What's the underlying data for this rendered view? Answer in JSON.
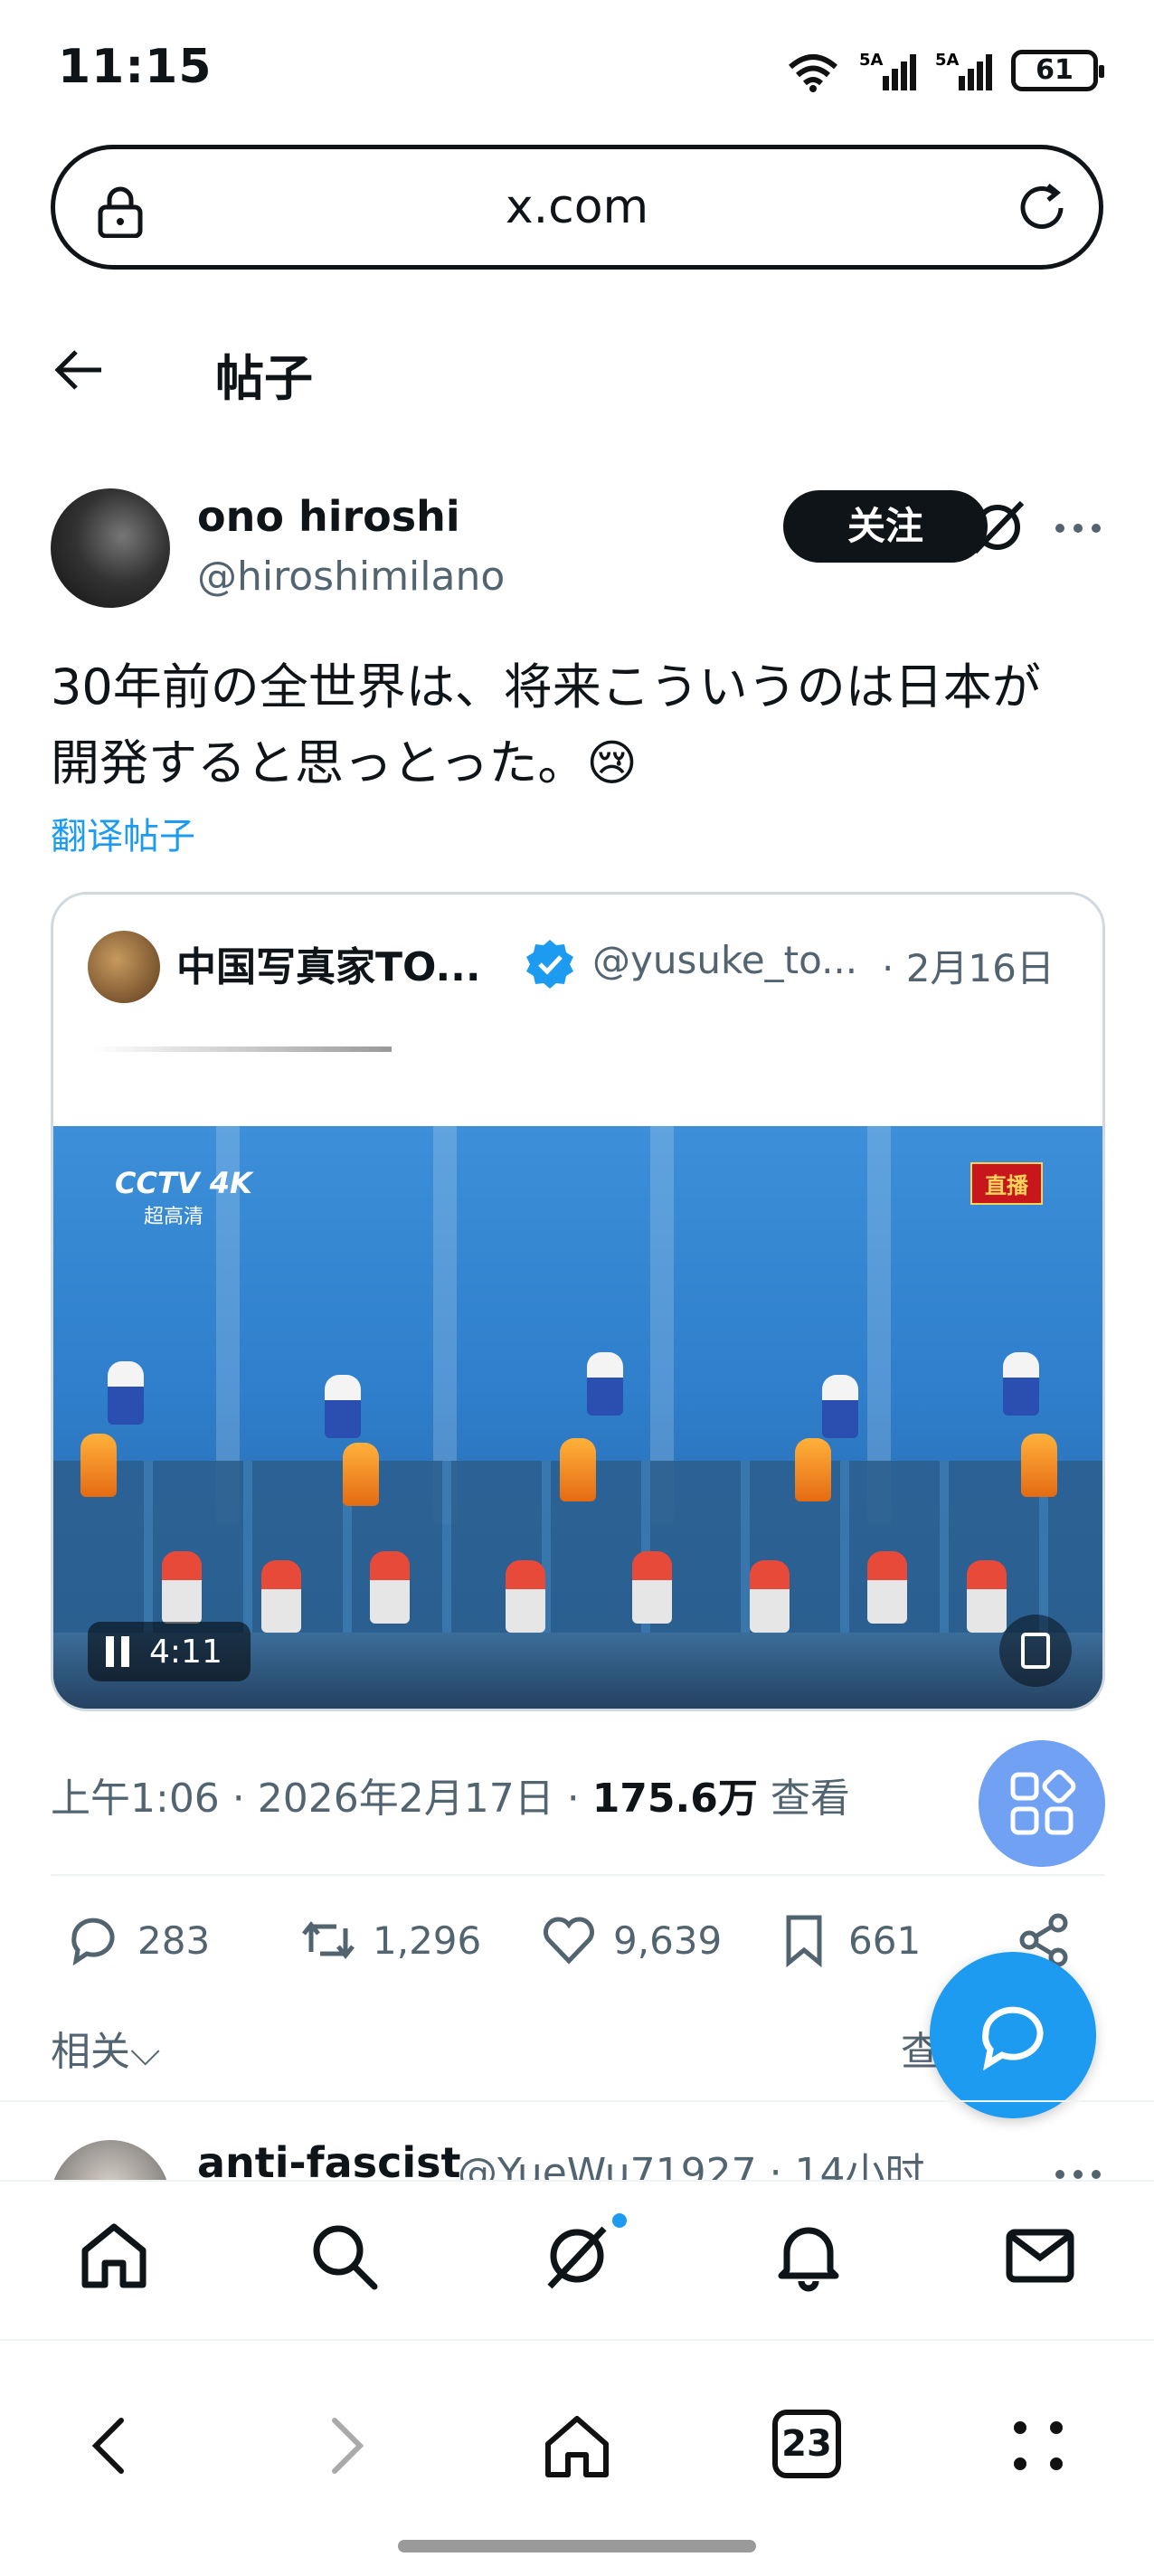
{
  "status_bar": {
    "time": "11:15",
    "battery": "61"
  },
  "browser": {
    "url": "x.com",
    "tabs_count": "23"
  },
  "header": {
    "title": "帖子"
  },
  "post": {
    "author_name": "ono hiroshi",
    "author_handle": "@hiroshimilano",
    "follow_label": "关注",
    "text_line1": "30年前の全世界は、将来こういうのは日本が",
    "text_line2": "開発すると思っとった。😢",
    "translate_label": "翻译帖子",
    "meta_time": "上午1:06 · 2026年2月17日 · ",
    "meta_views": "175.6万",
    "meta_views_label": " 查看"
  },
  "quote": {
    "author_name": "中国写真家TO...",
    "author_handle": "@yusuke_to...",
    "date": "· 2月16日",
    "video": {
      "channel": "CCTV 4K",
      "channel_sub": "超高清",
      "live_badge": "直播",
      "duration": "4:11"
    }
  },
  "actions": {
    "replies": "283",
    "reposts": "1,296",
    "likes": "9,639",
    "bookmarks": "661"
  },
  "related": {
    "label": "相关⌵",
    "view_more": "查"
  },
  "next_post": {
    "author_name": "anti-fascist",
    "author_handle": "@YueWu71927 · 14小时"
  },
  "colors": {
    "accent": "#1d9bf0",
    "text": "#0f1419",
    "muted": "#536471"
  },
  "icons": {
    "app_nav": [
      "home-icon",
      "search-icon",
      "grok-icon",
      "bell-icon",
      "mail-icon"
    ],
    "browser_nav": [
      "back-icon",
      "forward-icon",
      "home-icon",
      "tabs-icon",
      "menu-icon"
    ]
  }
}
